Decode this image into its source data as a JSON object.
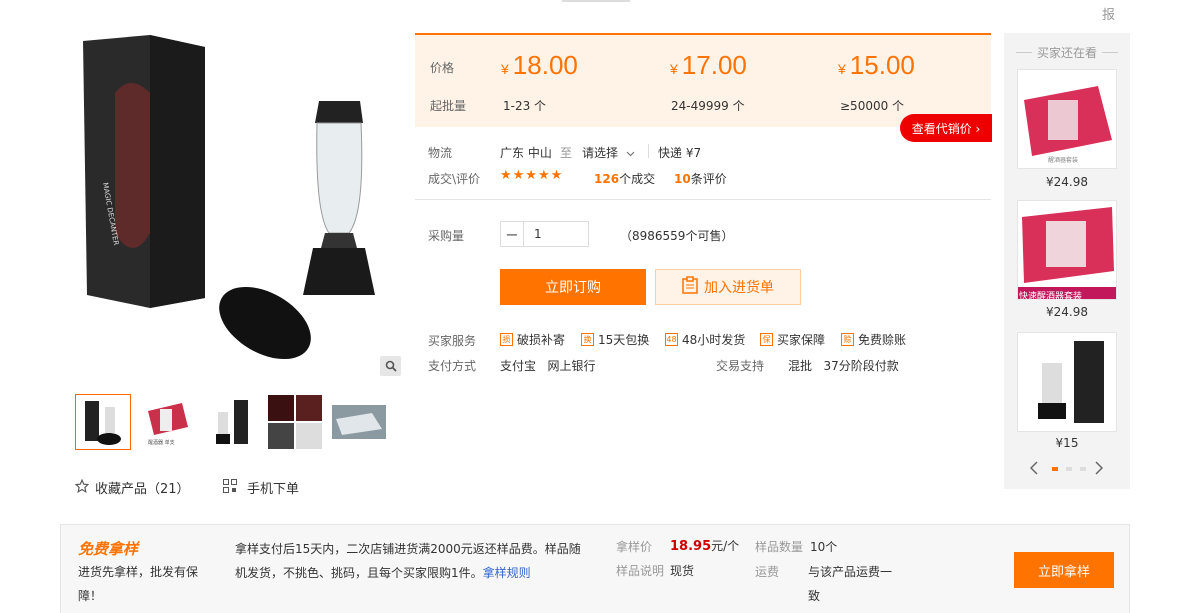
{
  "top": {
    "report_label": "报"
  },
  "gallery": {
    "thumbs": [
      "thumb-1",
      "thumb-2",
      "thumb-3",
      "thumb-4",
      "thumb-5"
    ],
    "favorite_label": "收藏产品（21）",
    "mobile_label": "手机下单"
  },
  "price": {
    "price_label": "价格",
    "batch_label": "起批量",
    "currency": "¥",
    "tiers": [
      {
        "price": "18.00",
        "range": "1-23 个"
      },
      {
        "price": "17.00",
        "range": "24-49999 个"
      },
      {
        "price": "15.00",
        "range": "≥50000 个"
      }
    ],
    "agent_button": "查看代销价 ›"
  },
  "logistics": {
    "label": "物流",
    "origin": "广东 中山",
    "to": "至",
    "destination": "请选择",
    "express": "快递 ¥7"
  },
  "deals": {
    "label": "成交\\评价",
    "stars": "★★★★★",
    "count": "126",
    "count_suffix": "个成交",
    "reviews": "10",
    "reviews_suffix": "条评价"
  },
  "purchase": {
    "label": "采购量",
    "quantity": "1",
    "available": "（8986559个可售）",
    "buy_button": "立即订购",
    "cart_button": "加入进货单"
  },
  "services": {
    "label": "买家服务",
    "items": [
      "破损补寄",
      "15天包换",
      "48小时发货",
      "买家保障",
      "免费赊账"
    ],
    "pay_label": "支付方式",
    "pay_values": "支付宝   网上银行",
    "trade_label": "交易支持",
    "trade_values": "混批   37分阶段付款"
  },
  "sidebar": {
    "title": "买家还在看",
    "items": [
      {
        "price": "¥24.98",
        "caption": ""
      },
      {
        "price": "¥24.98",
        "caption": "快速醒酒器套装"
      },
      {
        "price": "¥15",
        "caption": ""
      }
    ]
  },
  "sample": {
    "title": "免费拿样",
    "desc": "进货先拿样，批发有保障！",
    "rule_text": "拿样支付后15天内，二次店铺进货满2000元返还样品费。样品随机发货，不挑色、挑码，且每个买家限购1件。",
    "rule_link": "拿样规则",
    "price_label": "拿样价",
    "price_value": "18.95",
    "price_unit": "元/个",
    "qty_label": "样品数量",
    "qty_value": "10个",
    "note_label": "样品说明",
    "note_value": "现货",
    "ship_label": "运费",
    "ship_value": "与该产品运费一致",
    "button": "立即拿样"
  },
  "colors": {
    "accent": "#ff7300",
    "red": "#e00000",
    "price_bg": "#fff2e6"
  }
}
